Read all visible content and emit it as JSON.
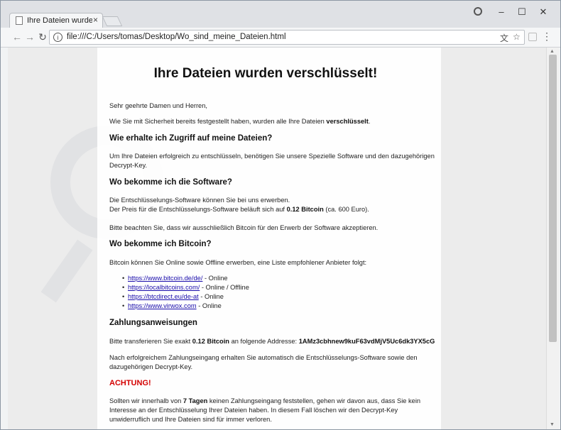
{
  "browser": {
    "tab_title": "Ihre Dateien wurden verschl",
    "tab_close": "×",
    "url": "file:///C:/Users/tomas/Desktop/Wo_sind_meine_Dateien.html",
    "win_min": "–",
    "win_max": "☐",
    "win_close": "✕",
    "back": "←",
    "forward": "→",
    "reload": "↻",
    "translate_icon": "文",
    "star_icon": "☆",
    "menu": "⋮",
    "info": "i"
  },
  "content": {
    "title": "Ihre Dateien wurden verschlüsselt!",
    "greeting": "Sehr geehrte Damen und Herren,",
    "intro_pre": "Wie Sie mit Sicherheit bereits festgestellt haben, wurden alle Ihre Dateien ",
    "intro_bold": "verschlüsselt",
    "intro_post": ".",
    "h_access": "Wie erhalte ich Zugriff auf meine Dateien?",
    "p_access": "Um Ihre Dateien erfolgreich zu entschlüsseln, benötigen Sie unsere Spezielle Software und den dazugehörigen Decrypt-Key.",
    "h_software": "Wo bekomme ich die Software?",
    "p_software_1": "Die Entschlüsselungs-Software können Sie bei uns erwerben.",
    "p_software_2_pre": "Der Preis für die Entschlüsselungs-Software beläuft sich auf ",
    "p_software_2_bold": "0.12 Bitcoin",
    "p_software_2_post": " (ca. 600 Euro).",
    "p_bitcoin_only": "Bitte beachten Sie, dass wir ausschließlich Bitcoin für den Erwerb der Software akzeptieren.",
    "h_bitcoin": "Wo bekomme ich Bitcoin?",
    "p_bitcoin": "Bitcoin können Sie Online sowie Offline erwerben, eine Liste empfohlener Anbieter folgt:",
    "links": [
      {
        "url": "https://www.bitcoin.de/de/",
        "note": " - Online"
      },
      {
        "url": "https://localbitcoins.com/",
        "note": " - Online / Offline"
      },
      {
        "url": "https://btcdirect.eu/de-at",
        "note": " - Online"
      },
      {
        "url": "https://www.virwox.com",
        "note": " - Online"
      }
    ],
    "h_payment": "Zahlungsanweisungen",
    "p_pay_pre": "Bitte transferieren Sie exakt ",
    "p_pay_amount": "0.12 Bitcoin",
    "p_pay_mid": " an folgende Addresse: ",
    "p_pay_address": "1AMz3cbhnew9kuF63vdMjV5Uc6dk3YX5cG",
    "p_after_payment": "Nach erfolgreichem Zahlungseingang erhalten Sie automatisch die Entschlüsselungs-Software sowie den dazugehörigen Decrypt-Key.",
    "warning": "ACHTUNG!",
    "p_warn_pre": "Sollten wir innerhalb von ",
    "p_warn_bold": "7 Tagen",
    "p_warn_post": " keinen Zahlungseingang feststellen, gehen wir davon aus, dass Sie kein Interesse an der Entschlüsselung Ihrer Dateien haben. In diesem Fall löschen wir den Decrypt-Key unwiderruflich und Ihre Dateien sind für immer verloren."
  }
}
